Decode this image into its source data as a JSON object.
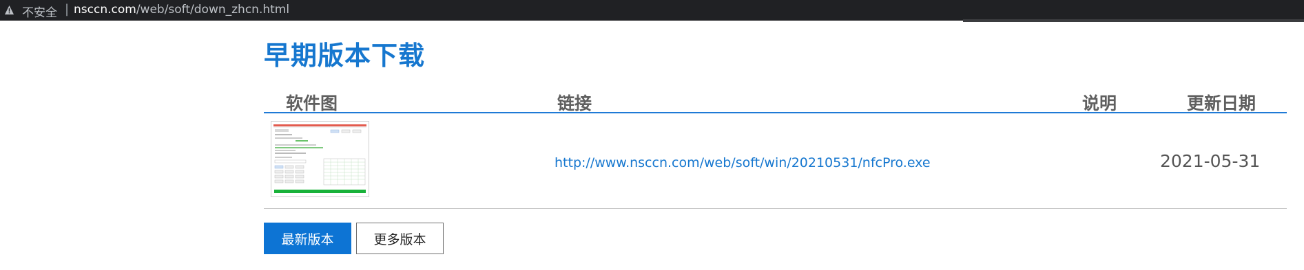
{
  "browser": {
    "security_label": "不安全",
    "separator": "|",
    "url_host": "nsccn.com",
    "url_path": "/web/soft/down_zhcn.html"
  },
  "page": {
    "title": "早期版本下载"
  },
  "table": {
    "headers": {
      "image": "软件图",
      "link": "链接",
      "description": "说明",
      "date": "更新日期"
    },
    "rows": [
      {
        "link": "http://www.nsccn.com/web/soft/win/20210531/nfcPro.exe",
        "description": "",
        "date": "2021-05-31"
      }
    ]
  },
  "buttons": {
    "latest": "最新版本",
    "more": "更多版本"
  },
  "colors": {
    "accent": "#1677cf",
    "primary_button": "#0d74d4"
  }
}
